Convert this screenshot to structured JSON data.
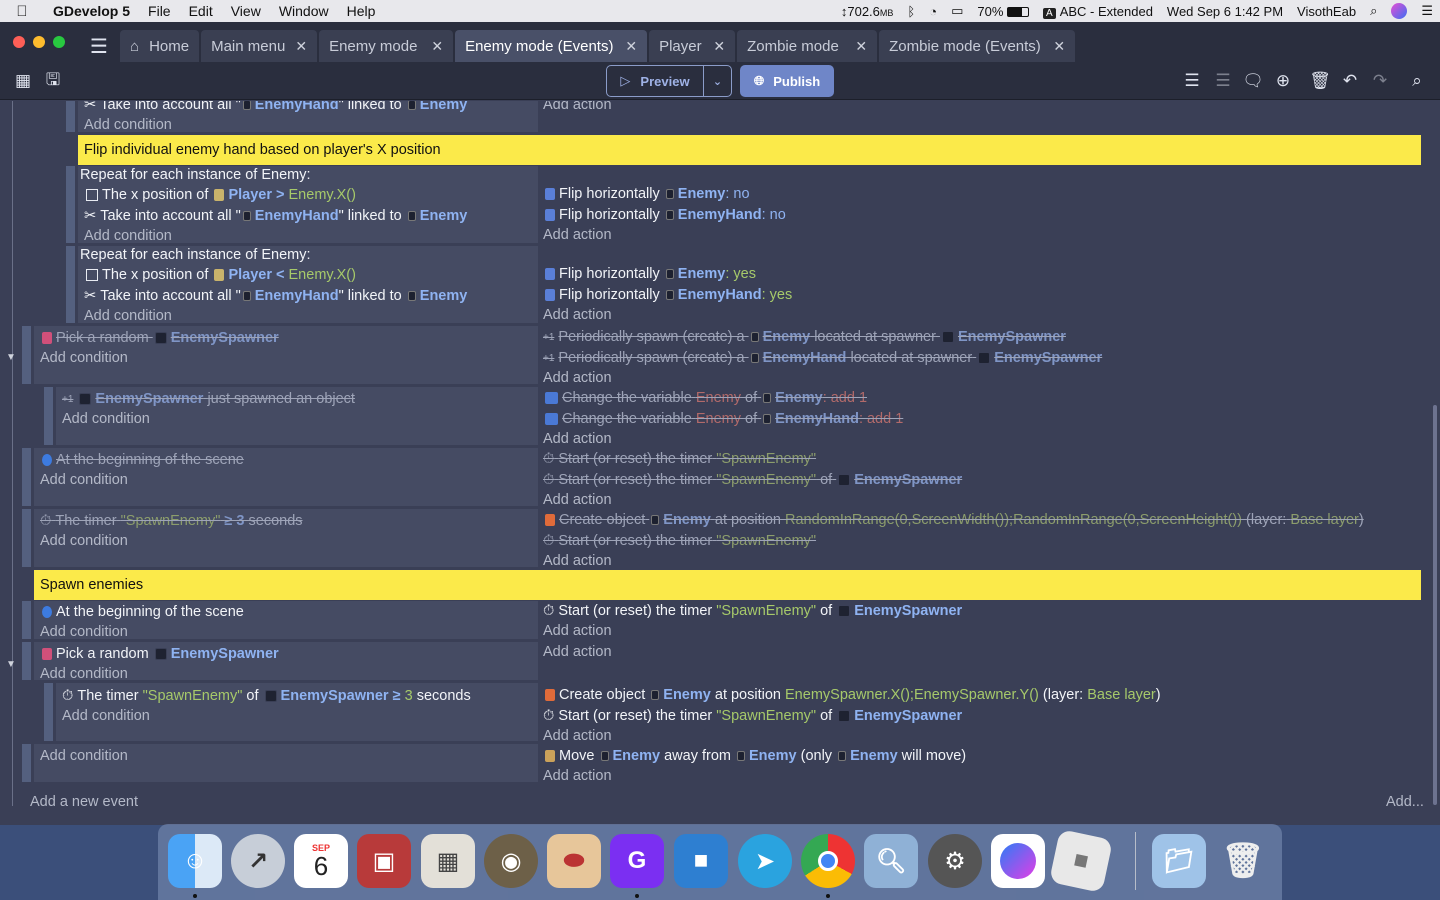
{
  "menubar": {
    "app_name": "GDevelop 5",
    "items": [
      "File",
      "Edit",
      "View",
      "Window",
      "Help"
    ],
    "network": "↕702.6",
    "network_unit": "MB",
    "battery": "70%",
    "keyboard": "A",
    "input_source": "ABC - Extended",
    "datetime": "Wed Sep 6  1:42 PM",
    "user": "VisothEab"
  },
  "tabs": [
    {
      "label": "Home",
      "icon": "home-icon"
    },
    {
      "label": "Main menu"
    },
    {
      "label": "Enemy mode"
    },
    {
      "label": "Enemy mode (Events)",
      "active": true
    },
    {
      "label": "Player"
    },
    {
      "label": "Zombie mode"
    },
    {
      "label": "Zombie mode (Events)"
    }
  ],
  "toolbar": {
    "preview": "Preview",
    "publish": "Publish"
  },
  "events": {
    "r0c": [
      "Take into account all \"",
      "EnemyHand",
      "\" linked to",
      "Enemy"
    ],
    "r0a": "Add action",
    "add_condition": "Add condition",
    "add_action": "Add action",
    "comment1": "Flip individual enemy hand based on player's X position",
    "repeat": "Repeat for each instance of Enemy:",
    "x_pos": "The x position of",
    "player": "Player",
    "gt": ">",
    "lt": "<",
    "enemy_x": "Enemy.X()",
    "take_all": "Take into account all \"",
    "enemyhand": "EnemyHand",
    "linked_to": "\" linked to",
    "enemy": "Enemy",
    "flip_h": "Flip horizontally",
    "colon_no": ": no",
    "colon_yes": ": yes",
    "pick_random": "Pick a random",
    "enemyspawner": "EnemySpawner",
    "periodic": "Periodically spawn (create) a",
    "located_at": "located at spawner",
    "just_spawned": "just spawned an object",
    "change_var": "Change the variable",
    "of": "of",
    "add_1": ": add 1",
    "beginning": "At the beginning of the scene",
    "start_timer": "Start (or reset) the timer",
    "spawn_enemy_str": "\"SpawnEnemy\"",
    "the_timer": "The timer",
    "ge3": "≥ 3",
    "ge": "≥",
    "three": "3",
    "seconds": "seconds",
    "create_object": "Create object",
    "at_position": "at position",
    "random_pos": "RandomInRange(0,ScreenWidth());RandomInRange(0,ScreenHeight())",
    "layer_open": "(layer:",
    "base_layer": "Base layer",
    "close_paren": ")",
    "comment2": "Spawn enemies",
    "spawner_pos": "EnemySpawner.X();EnemySpawner.Y()",
    "move": "Move",
    "away_from": "away from",
    "only": "(only",
    "will_move": "will move)",
    "plus1": "+1",
    "add_new_event": "Add a new event",
    "add_dots": "Add..."
  },
  "dock": {
    "items": [
      {
        "name": "finder",
        "running": true
      },
      {
        "name": "launchpad"
      },
      {
        "name": "calendar",
        "label": "6",
        "month": "SEP"
      },
      {
        "name": "photo-booth"
      },
      {
        "name": "calculator"
      },
      {
        "name": "gimp"
      },
      {
        "name": "paint"
      },
      {
        "name": "gdevelop",
        "running": true
      },
      {
        "name": "lego"
      },
      {
        "name": "telegram"
      },
      {
        "name": "chrome",
        "running": true
      },
      {
        "name": "preview"
      },
      {
        "name": "system-preferences"
      },
      {
        "name": "messenger"
      },
      {
        "name": "roblox"
      },
      {
        "name": "downloads-folder"
      },
      {
        "name": "trash"
      }
    ]
  },
  "colors": {
    "accent": "#6f86c8",
    "comment": "#fbea4a",
    "background": "#3a3f56"
  }
}
